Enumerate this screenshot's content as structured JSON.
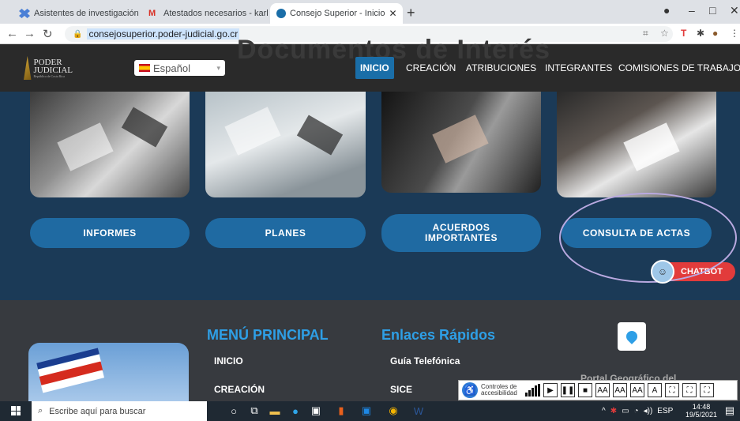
{
  "browser": {
    "tabs": [
      {
        "title": "Asistentes de investigación - Dro",
        "color": "#4a7fd6"
      },
      {
        "title": "Atestados necesarios - karlissa.z",
        "color": "#d93025"
      },
      {
        "title": "Consejo Superior - Inicio",
        "color": "#1a6ea8"
      }
    ],
    "new_tab": "+",
    "url": "consejosuperior.poder-judicial.go.cr",
    "window_minimize": "–",
    "window_maximize": "□",
    "window_close": "✕"
  },
  "header": {
    "ghost_title": "Documentos de Interés",
    "logo_line1": "PODER",
    "logo_line2": "JUDICIAL",
    "logo_sub": "República de Costa Rica",
    "language": "Español",
    "nav": [
      "INICIO",
      "CREACIÓN",
      "ATRIBUCIONES",
      "INTEGRANTES",
      "COMISIONES DE TRABAJO"
    ],
    "active_nav": "INICIO"
  },
  "cards": [
    {
      "label": "INFORMES"
    },
    {
      "label": "PLANES"
    },
    {
      "label": "ACUERDOS IMPORTANTES"
    },
    {
      "label": "CONSULTA DE ACTAS"
    }
  ],
  "chatbot": {
    "label": "CHATBOT"
  },
  "footer": {
    "menu_title": "MENÚ PRINCIPAL",
    "menu_items": [
      "INICIO",
      "CREACIÓN"
    ],
    "links_title": "Enlaces Rápidos",
    "links": [
      "Guía Telefónica",
      "SICE"
    ],
    "partial_text": "Portal Geográfico del"
  },
  "accessibility": {
    "label": "Controles de accesibilidad",
    "buttons": [
      "▶",
      "❚❚",
      "■",
      "AA",
      "AA",
      "AA",
      "A",
      "⛶",
      "⛶",
      "⛶"
    ]
  },
  "taskbar": {
    "search_placeholder": "Escribe aquí para buscar",
    "lang": "ESP",
    "time": "14:48",
    "date": "19/5/2021"
  },
  "colors": {
    "page_bg": "#1b3a57",
    "button_blue": "#1f6aa2",
    "accent_blue": "#2e9fe6",
    "chatbot_red": "#e23b3b"
  }
}
